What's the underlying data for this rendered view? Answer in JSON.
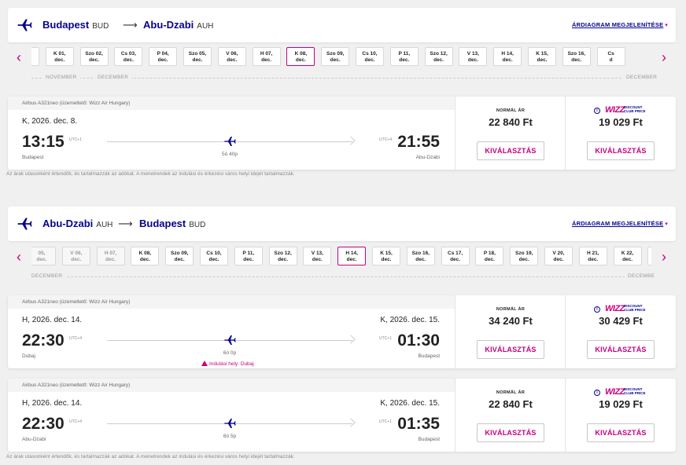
{
  "outbound": {
    "header": {
      "from": "Budapest",
      "from_code": "BUD",
      "arrow": "⟶",
      "to": "Abu-Dzabi",
      "to_code": "AUH",
      "chart_link": "ÁRDIAGRAM MEGJELENÍTÉSE",
      "caret": "▾"
    },
    "nav": {
      "prev": "‹",
      "next": "›"
    },
    "dates": [
      {
        "l1": "",
        "l2": "",
        "state": "partial"
      },
      {
        "l1": "K 01,",
        "l2": "dec."
      },
      {
        "l1": "Szo 02,",
        "l2": "dec."
      },
      {
        "l1": "Cs 03,",
        "l2": "dec."
      },
      {
        "l1": "P 04,",
        "l2": "dec."
      },
      {
        "l1": "Szo 05,",
        "l2": "dec."
      },
      {
        "l1": "V 06,",
        "l2": "dec."
      },
      {
        "l1": "H 07,",
        "l2": "dec."
      },
      {
        "l1": "K 08,",
        "l2": "dec.",
        "state": "selected"
      },
      {
        "l1": "Szo 09,",
        "l2": "dec."
      },
      {
        "l1": "Cs 10,",
        "l2": "dec."
      },
      {
        "l1": "P 11,",
        "l2": "dec."
      },
      {
        "l1": "Szo 12,",
        "l2": "dec."
      },
      {
        "l1": "V 13,",
        "l2": "dec."
      },
      {
        "l1": "H 14,",
        "l2": "dec."
      },
      {
        "l1": "K 15,",
        "l2": "dec."
      },
      {
        "l1": "Szo 16,",
        "l2": "dec."
      },
      {
        "l1": "Cs",
        "l2": "d"
      }
    ],
    "months": {
      "m1": "NOVEMBER",
      "m2": "DECEMBER",
      "m3": "DECEMBER"
    },
    "flights": [
      {
        "aircraft": "Airbus A321neo (üzemeltető: Wizz Air Hungary)",
        "date_left": "K, 2026. dec. 8.",
        "date_right": "",
        "dep_time": "13:15",
        "dep_utc": "UTC+1",
        "dep_city": "Budapest",
        "arr_time": "21:55",
        "arr_utc": "UTC+4",
        "arr_city": "Abu-Dzabi",
        "duration": "5ó 40p",
        "notice": "",
        "normal_label": "NORMÁL ÁR",
        "normal_price": "22 840 Ft",
        "club_price": "19 029 Ft",
        "select_label": "KIVÁLASZTÁS"
      }
    ],
    "footnote": "Az árak utasonként értendők, és tartalmazzák az adókat. A menetrendek az indulási és érkezési város helyi idejét tartalmazzák."
  },
  "inbound": {
    "header": {
      "from": "Abu-Dzabi",
      "from_code": "AUH",
      "arrow": "⟶",
      "to": "Budapest",
      "to_code": "BUD",
      "chart_link": "ÁRDIAGRAM MEGJELENÍTÉSE",
      "caret": "▾"
    },
    "nav": {
      "prev": "‹",
      "next": "›"
    },
    "dates": [
      {
        "l1": "05,",
        "l2": "dec.",
        "state": "faded"
      },
      {
        "l1": "V 06,",
        "l2": "dec.",
        "state": "faded"
      },
      {
        "l1": "H 07,",
        "l2": "dec.",
        "state": "faded"
      },
      {
        "l1": "K 08,",
        "l2": "dec."
      },
      {
        "l1": "Szo 09,",
        "l2": "dec."
      },
      {
        "l1": "Cs 10,",
        "l2": "dec."
      },
      {
        "l1": "P 11,",
        "l2": "dec."
      },
      {
        "l1": "Szo 12,",
        "l2": "dec."
      },
      {
        "l1": "V 13,",
        "l2": "dec."
      },
      {
        "l1": "H 14,",
        "l2": "dec.",
        "state": "selected"
      },
      {
        "l1": "K 15,",
        "l2": "dec."
      },
      {
        "l1": "Szo 16,",
        "l2": "dec."
      },
      {
        "l1": "Cs 17,",
        "l2": "dec."
      },
      {
        "l1": "P 18,",
        "l2": "dec."
      },
      {
        "l1": "Szo 19,",
        "l2": "dec."
      },
      {
        "l1": "V 20,",
        "l2": "dec."
      },
      {
        "l1": "H 21,",
        "l2": "dec."
      },
      {
        "l1": "K 22,",
        "l2": "dec."
      },
      {
        "l1": "Szo",
        "l2": "de"
      }
    ],
    "months": {
      "m1": "DECEMBER",
      "m2": "DECEMBE"
    },
    "flights": [
      {
        "aircraft": "Airbus A321neo (üzemeltető: Wizz Air Hungary)",
        "date_left": "H, 2026. dec. 14.",
        "date_right": "K, 2026. dec. 15.",
        "dep_time": "22:30",
        "dep_utc": "UTC+4",
        "dep_city": "Dubaj",
        "arr_time": "01:30",
        "arr_utc": "UTC+1",
        "arr_city": "Budapest",
        "duration": "6ó 0p",
        "notice": "Indulási hely: Dubaj",
        "normal_label": "NORMÁL ÁR",
        "normal_price": "34 240 Ft",
        "club_price": "30 429 Ft",
        "select_label": "KIVÁLASZTÁS"
      },
      {
        "aircraft": "Airbus A321neo (üzemeltető: Wizz Air Hungary)",
        "date_left": "H, 2026. dec. 14.",
        "date_right": "K, 2026. dec. 15.",
        "dep_time": "22:30",
        "dep_utc": "UTC+4",
        "dep_city": "Abu-Dzabi",
        "arr_time": "01:35",
        "arr_utc": "UTC+1",
        "arr_city": "Budapest",
        "duration": "6ó 5p",
        "notice": "",
        "normal_label": "NORMÁL ÁR",
        "normal_price": "22 840 Ft",
        "club_price": "19 029 Ft",
        "select_label": "KIVÁLASZTÁS"
      }
    ],
    "footnote": "Az árak utasonként értendők, és tartalmazzák az adókat. A menetrendek az indulási és érkezési város helyi idejét tartalmazzák."
  },
  "club_logo": {
    "wizz": "WIZZ",
    "line1": "DISCOUNT",
    "line2": "CLUB PRICE",
    "info": "i"
  },
  "colors": {
    "brand_navy": "#06038d",
    "brand_magenta": "#c6007e"
  }
}
